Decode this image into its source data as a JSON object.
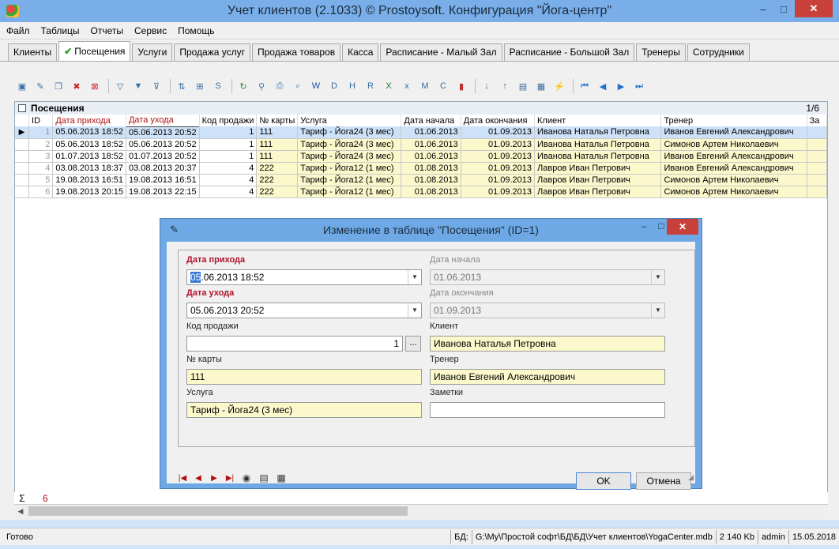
{
  "window": {
    "title": "Учет клиентов (2.1033) © Prostoysoft. Конфигурация \"Йога-центр\"",
    "min": "–",
    "max": "□",
    "close": "✕"
  },
  "menu": [
    "Файл",
    "Таблицы",
    "Отчеты",
    "Сервис",
    "Помощь"
  ],
  "tabs": [
    "Клиенты",
    "Посещения",
    "Услуги",
    "Продажа услуг",
    "Продажа товаров",
    "Касса",
    "Расписание - Малый Зал",
    "Расписание - Большой Зал",
    "Тренеры",
    "Сотрудники"
  ],
  "active_tab": "Посещения",
  "toolbar_icons": [
    "add-record-icon",
    "edit-record-icon",
    "copy-record-icon",
    "delete-record-icon",
    "delete-all-icon",
    "filter-icon",
    "filter-add-icon",
    "filter-clear-icon",
    "sort-icon",
    "group-icon",
    "sql-icon",
    "refresh-icon",
    "find-icon",
    "print-icon",
    "preview-icon",
    "export-word-icon",
    "export-doc-icon",
    "export-html-icon",
    "export-rtf-icon",
    "export-excel-icon",
    "export-xls-icon",
    "export-xml-icon",
    "export-csv-icon",
    "chart-icon",
    "sort-asc-icon",
    "sort-desc-icon",
    "form-icon",
    "report-icon",
    "action-icon",
    "first-icon",
    "prev-icon",
    "next-icon",
    "last-icon"
  ],
  "grid": {
    "title": "Посещения",
    "count": "1/6",
    "columns": [
      "ID",
      "Дата прихода",
      "Дата ухода",
      "Код продажи",
      "№ карты",
      "Услуга",
      "Дата начала",
      "Дата окончания",
      "Клиент",
      "Тренер",
      "За"
    ],
    "rows": [
      [
        "1",
        "05.06.2013 18:52",
        "05.06.2013 20:52",
        "1",
        "111",
        "Тариф - Йога24 (3 мес)",
        "01.06.2013",
        "01.09.2013",
        "Иванова Наталья Петровна",
        "Иванов Евгений Александрович"
      ],
      [
        "2",
        "05.06.2013 18:52",
        "05.06.2013 20:52",
        "1",
        "111",
        "Тариф - Йога24 (3 мес)",
        "01.06.2013",
        "01.09.2013",
        "Иванова Наталья Петровна",
        "Симонов Артем Николаевич"
      ],
      [
        "3",
        "01.07.2013 18:52",
        "01.07.2013 20:52",
        "1",
        "111",
        "Тариф - Йога24 (3 мес)",
        "01.06.2013",
        "01.09.2013",
        "Иванова Наталья Петровна",
        "Иванов Евгений Александрович"
      ],
      [
        "4",
        "03.08.2013 18:37",
        "03.08.2013 20:37",
        "4",
        "222",
        "Тариф - Йога12 (1 мес)",
        "01.08.2013",
        "01.09.2013",
        "Лавров Иван Петрович",
        "Иванов Евгений Александрович"
      ],
      [
        "5",
        "19.08.2013 16:51",
        "19.08.2013 16:51",
        "4",
        "222",
        "Тариф - Йога12 (1 мес)",
        "01.08.2013",
        "01.09.2013",
        "Лавров Иван Петрович",
        "Симонов Артем Николаевич"
      ],
      [
        "6",
        "19.08.2013 20:15",
        "19.08.2013 22:15",
        "4",
        "222",
        "Тариф - Йога12 (1 мес)",
        "01.08.2013",
        "01.09.2013",
        "Лавров Иван Петрович",
        "Симонов Артем Николаевич"
      ]
    ],
    "sum_symbol": "Σ",
    "sum_value": "6"
  },
  "dialog": {
    "title": "Изменение в таблице \"Посещения\" (ID=1)",
    "fields": {
      "arrival_label": "Дата прихода",
      "arrival_cursor": "05",
      "arrival_value": ".06.2013 18:52",
      "departure_label": "Дата ухода",
      "departure_value": "05.06.2013 20:52",
      "sale_code_label": "Код продажи",
      "sale_code_value": "1",
      "card_label": "№ карты",
      "card_value": "111",
      "service_label": "Услуга",
      "service_value": "Тариф - Йога24 (3 мес)",
      "start_label": "Дата начала",
      "start_value": "01.06.2013",
      "end_label": "Дата окончания",
      "end_value": "01.09.2013",
      "client_label": "Клиент",
      "client_value": "Иванова Наталья Петровна",
      "trainer_label": "Тренер",
      "trainer_value": "Иванов Евгений Александрович",
      "notes_label": "Заметки",
      "notes_value": ""
    },
    "lookup_button": "...",
    "ok": "OK",
    "cancel": "Отмена"
  },
  "status": {
    "ready": "Готово",
    "db_label": "БД:",
    "db_path": "G:\\My\\Простой софт\\БД\\БД\\Учет клиентов\\YogaCenter.mdb",
    "size": "2 140 Kb",
    "user": "admin",
    "date": "15.05.2018"
  },
  "colors": {
    "title_bar": "#79aee8",
    "required_label": "#b0102a",
    "lookup_field": "#fbf8cc",
    "selected_row": "#cde1f8",
    "close_button": "#c8403a"
  }
}
